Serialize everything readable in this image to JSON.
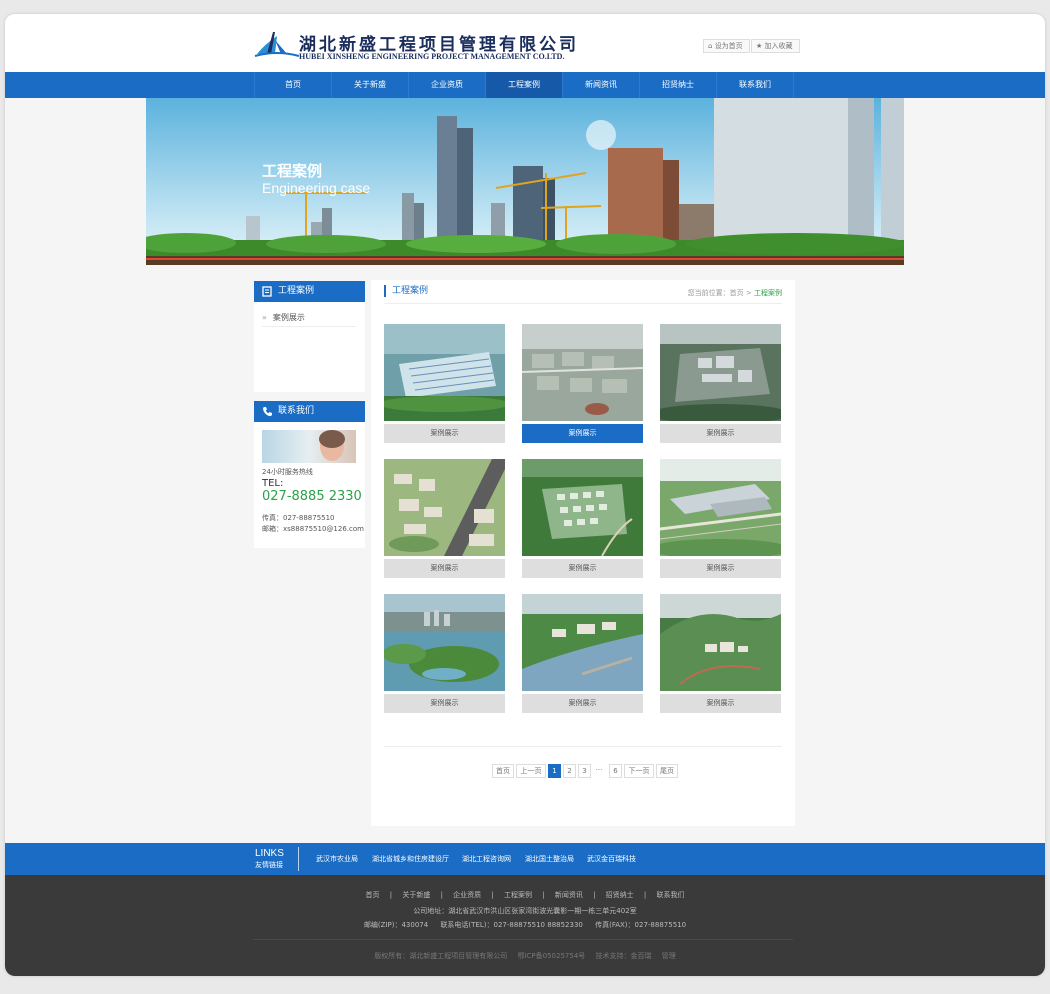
{
  "header": {
    "brand_cn": "湖北新盛工程项目管理有限公司",
    "brand_en": "HUBEI XINSHENG ENGINEERING PROJECT MANAGEMENT CO.LTD.",
    "set_home": "设为首页",
    "add_fav": "加入收藏"
  },
  "nav": {
    "items": [
      "首页",
      "关于新盛",
      "企业资质",
      "工程案例",
      "新闻资讯",
      "招贤纳士",
      "联系我们"
    ],
    "active_index": 3
  },
  "banner": {
    "title": "工程案例",
    "subtitle": "Engineering case"
  },
  "sidebar": {
    "cases_title": "工程案例",
    "cases_items": [
      "案例展示"
    ],
    "contact_title": "联系我们",
    "hotline_label": "24小时服务热线",
    "tel_label": "TEL:",
    "tel_number": "027-8885 2330",
    "fax": "传真：027-88875510",
    "email": "邮箱：xs88875510@126.com"
  },
  "main": {
    "title": "工程案例",
    "breadcrumb_prefix": "您当前位置：",
    "breadcrumb_home": "首页",
    "breadcrumb_sep": ">",
    "breadcrumb_current": "工程案例",
    "cards": [
      {
        "caption": "案例展示",
        "active": false
      },
      {
        "caption": "案例展示",
        "active": true
      },
      {
        "caption": "案例展示",
        "active": false
      },
      {
        "caption": "案例展示",
        "active": false
      },
      {
        "caption": "案例展示",
        "active": false
      },
      {
        "caption": "案例展示",
        "active": false
      },
      {
        "caption": "案例展示",
        "active": false
      },
      {
        "caption": "案例展示",
        "active": false
      },
      {
        "caption": "案例展示",
        "active": false
      }
    ],
    "pagination": {
      "first": "首页",
      "prev": "上一页",
      "pages": [
        "1",
        "2",
        "3"
      ],
      "current": "1",
      "ellipsis": "···",
      "last_page": "6",
      "next": "下一页",
      "last": "尾页"
    }
  },
  "links": {
    "title": "LINKS",
    "subtitle": "友情链接",
    "items": [
      "武汉市农业局",
      "湖北省城乡和住房建设厅",
      "湖北工程咨询网",
      "湖北国土整治局",
      "武汉金百瑞科技"
    ]
  },
  "footer": {
    "nav": [
      "首页",
      "关于新盛",
      "企业资质",
      "工程案例",
      "新闻资讯",
      "招贤纳士",
      "联系我们"
    ],
    "address": "公司地址：湖北省武汉市洪山区张家湾街波光囊影一期一栋三单元402室",
    "zip": "邮编(ZIP)：430074",
    "phone": "联系电话(TEL)：027-88875510 88852330",
    "fax": "传真(FAX)：027-88875510",
    "copyright": "版权所有：湖北新盛工程项目管理有限公司",
    "icp": "鄂ICP备05025754号",
    "tech": "技术支持：金百瑞",
    "admin": "管理"
  },
  "colors": {
    "primary_blue": "#1a6cc4",
    "dark_footer": "#3a3a3a",
    "highlight_green": "#2ba14a"
  }
}
